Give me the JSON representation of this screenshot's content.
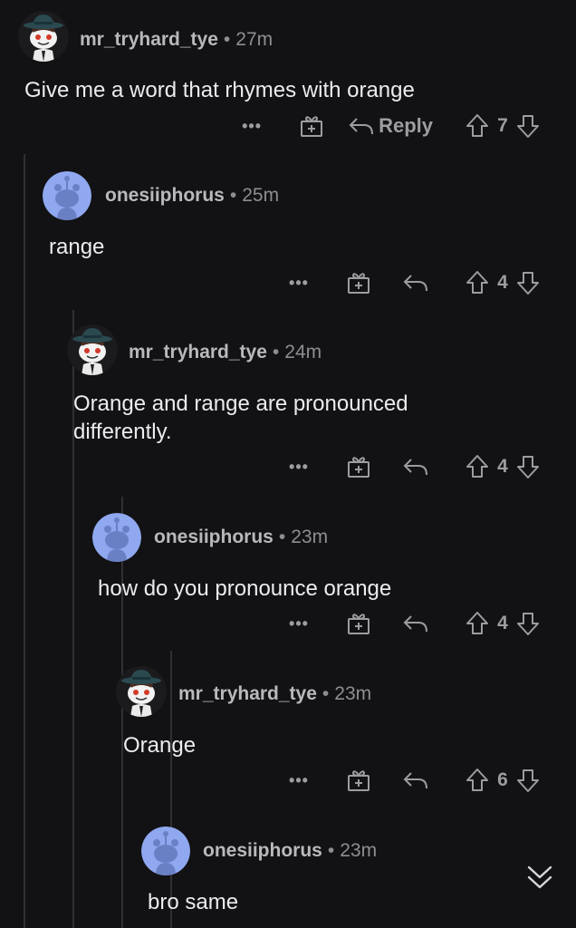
{
  "comments": [
    {
      "username": "mr_tryhard_tye",
      "separator": "•",
      "time": "27m",
      "avatar": "tophat-snoo-avatar",
      "text": [
        "Give me a word that rhymes with orange"
      ],
      "reply_label": "Reply",
      "votes": "7"
    },
    {
      "username": "onesiiphorus",
      "separator": "•",
      "time": "25m",
      "avatar": "default-snoo-avatar",
      "text": [
        "range"
      ],
      "votes": "4"
    },
    {
      "username": "mr_tryhard_tye",
      "separator": "•",
      "time": "24m",
      "avatar": "tophat-snoo-avatar",
      "text": [
        "Orange and range are pronounced",
        "differently."
      ],
      "votes": "4"
    },
    {
      "username": "onesiiphorus",
      "separator": "•",
      "time": "23m",
      "avatar": "default-snoo-avatar",
      "text": [
        "how do you pronounce orange"
      ],
      "votes": "4"
    },
    {
      "username": "mr_tryhard_tye",
      "separator": "•",
      "time": "23m",
      "avatar": "tophat-snoo-avatar",
      "text": [
        "Orange"
      ],
      "votes": "6"
    },
    {
      "username": "onesiiphorus",
      "separator": "•",
      "time": "23m",
      "avatar": "default-snoo-avatar",
      "text": [
        "bro same"
      ]
    }
  ],
  "more_glyph": "•••",
  "icons": {
    "more": "more-options-icon",
    "award": "gift-award-icon",
    "reply": "reply-arrow-icon",
    "upvote": "upvote-arrow-icon",
    "downvote": "downvote-arrow-icon",
    "collapse": "double-chevron-down-icon"
  },
  "colors": {
    "background": "#121214",
    "thread_line": "#303033",
    "username": "#b9b9bd",
    "meta": "#8d8d92",
    "text": "#ececee",
    "action": "#9c9ca1",
    "avatar_blue": "#8fa8f0"
  }
}
